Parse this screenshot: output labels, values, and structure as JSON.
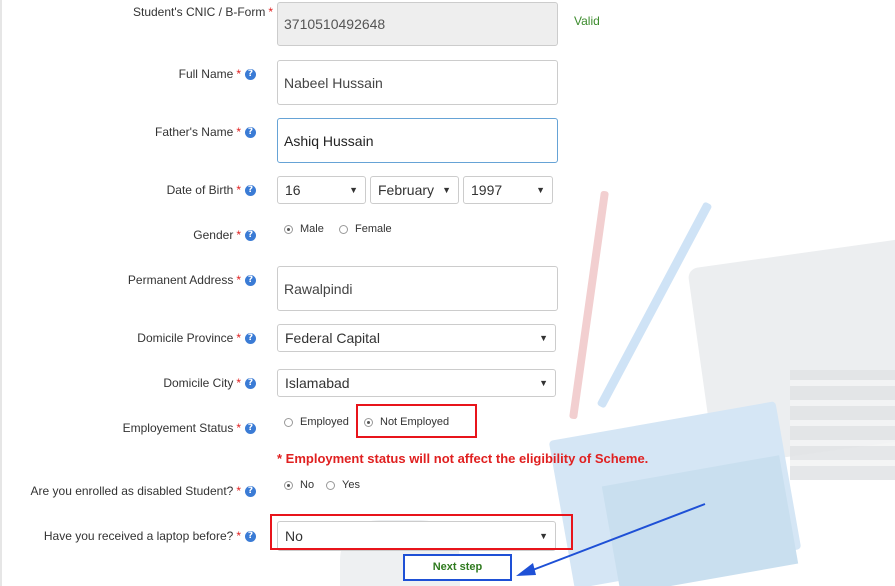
{
  "fields": {
    "cnic": {
      "label": "Student's CNIC / B-Form",
      "value": "3710510492648",
      "status": "Valid"
    },
    "full_name": {
      "label": "Full Name",
      "value": "Nabeel Hussain"
    },
    "father_name": {
      "label": "Father's Name",
      "value": "Ashiq Hussain"
    },
    "dob": {
      "label": "Date of Birth",
      "day": "16",
      "month": "February",
      "year": "1997"
    },
    "gender": {
      "label": "Gender",
      "options": [
        "Male",
        "Female"
      ],
      "selected": "Male"
    },
    "address": {
      "label": "Permanent Address",
      "value": "Rawalpindi"
    },
    "domicile_province": {
      "label": "Domicile Province",
      "value": "Federal Capital"
    },
    "domicile_city": {
      "label": "Domicile City",
      "value": "Islamabad"
    },
    "employment": {
      "label": "Employement Status",
      "options": [
        "Employed",
        "Not Employed"
      ],
      "selected": "Not Employed"
    },
    "employment_notice": "* Employment status will not affect the eligibility of Scheme.",
    "disabled": {
      "label": "Are you enrolled as disabled Student?",
      "options": [
        "No",
        "Yes"
      ],
      "selected": "No"
    },
    "laptop": {
      "label": "Have you received a laptop before?",
      "value": "No"
    }
  },
  "required_mark": "*",
  "help_glyph": "?",
  "caret_glyph": "▼",
  "next_button": "Next step",
  "colors": {
    "required": "#e02020",
    "valid": "#3c8b2c",
    "help": "#3a7bd5",
    "highlight_red": "#e8141b",
    "highlight_blue": "#1e50d6",
    "next_text": "#2f7a1f"
  }
}
